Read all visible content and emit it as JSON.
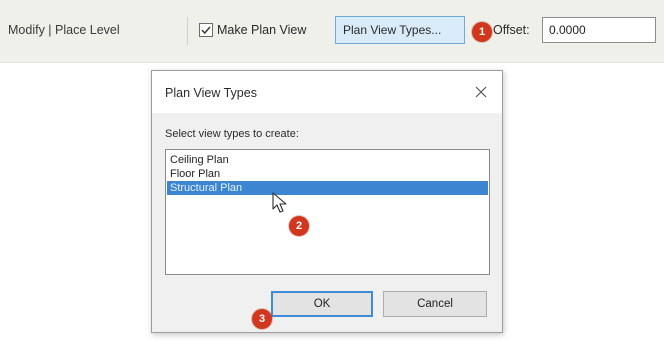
{
  "options_bar": {
    "context_label": "Modify | Place Level",
    "make_plan_view": {
      "label": "Make Plan View",
      "checked": true
    },
    "plan_view_types_button": "Plan View Types...",
    "offset_label": "Offset:",
    "offset_value": "0.0000"
  },
  "callouts": {
    "one": "1",
    "two": "2",
    "three": "3"
  },
  "dialog": {
    "title": "Plan View Types",
    "instruction": "Select view types to create:",
    "items": [
      {
        "label": "Ceiling Plan",
        "selected": false
      },
      {
        "label": "Floor Plan",
        "selected": false
      },
      {
        "label": "Structural Plan",
        "selected": true
      }
    ],
    "ok_label": "OK",
    "cancel_label": "Cancel"
  },
  "icons": {
    "check": "check-icon",
    "close": "close-icon",
    "cursor": "mouse-pointer-icon"
  },
  "colors": {
    "options_bar_bg": "#eef0e9",
    "button_highlight": "#d9ebf8",
    "selection": "#3c86d1",
    "callout": "#d2371d",
    "ok_focus_border": "#3f8bd6"
  }
}
